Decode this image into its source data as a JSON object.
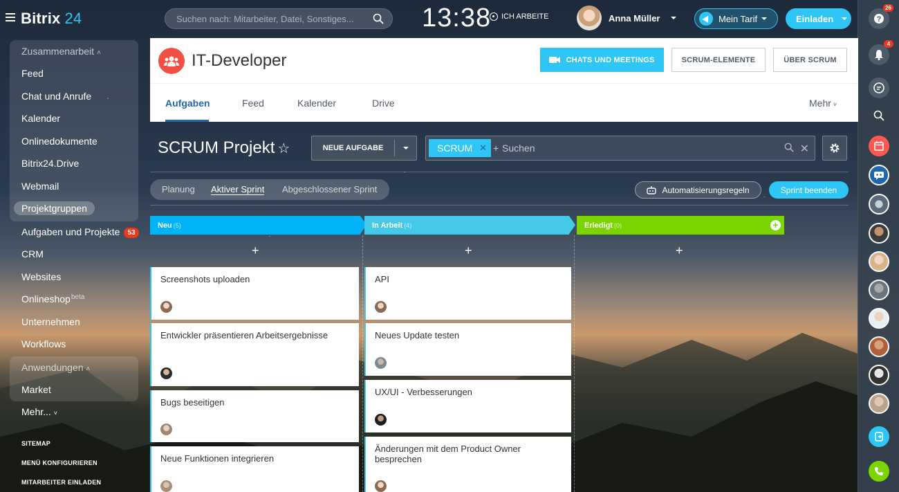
{
  "topbar": {
    "logo_text": "Bitrix",
    "logo_num": "24",
    "search_placeholder": "Suchen nach: Mitarbeiter, Datei, Sonstiges...",
    "clock": "13:38",
    "work_status": "ICH ARBEITE",
    "user_name": "Anna Müller",
    "tarif": "Mein Tarif",
    "invite": "Einladen"
  },
  "rail": {
    "help_badge": "26",
    "notifications_badge": "4"
  },
  "nav": {
    "group1_head": "Zusammenarbeit",
    "items1": [
      "Feed",
      "Chat und Anrufe",
      "Kalender",
      "Onlinedokumente",
      "Bitrix24.Drive",
      "Webmail",
      "Projektgruppen"
    ],
    "tasks": "Aufgaben und Projekte",
    "tasks_count": "53",
    "items2": [
      "CRM",
      "Websites"
    ],
    "shop": "Onlineshop",
    "shop_beta": "beta",
    "items3": [
      "Unternehmen",
      "Workflows"
    ],
    "group2_head": "Anwendungen",
    "market": "Market",
    "more": "Mehr...",
    "sitemap": "SITEMAP",
    "configure": "MENÜ KONFIGURIEREN",
    "invite_staff": "MITARBEITER EINLADEN"
  },
  "group": {
    "title": "IT-Developer",
    "btn_chats": "CHATS UND MEETINGS",
    "btn_elements": "SCRUM-ELEMENTE",
    "btn_about": "ÜBER SCRUM",
    "tabs": [
      "Aufgaben",
      "Feed",
      "Kalender",
      "Drive"
    ],
    "more": "Mehr"
  },
  "scrum": {
    "title": "SCRUM Projekt",
    "new_task": "NEUE AUFGABE",
    "filter_chip": "SCRUM",
    "filter_placeholder": "Suchen",
    "sprint_tabs": [
      "Planung",
      "Aktiver Sprint",
      "Abgeschlossener Sprint"
    ],
    "automation": "Automatisierungsregeln",
    "end_sprint": "Sprint beenden"
  },
  "kanban": {
    "columns": [
      {
        "title": "Neu",
        "count": "(5)"
      },
      {
        "title": "In Arbeit",
        "count": "(4)"
      },
      {
        "title": "Erledigt",
        "count": "(0)"
      }
    ],
    "col1_cards": [
      "Screenshots uploaden",
      "Entwickler präsentieren Arbeitsergebnisse",
      "Bugs beseitigen",
      "Neue Funktionen integrieren"
    ],
    "col2_cards": [
      "API",
      "Neues Update testen",
      "UX/UI - Verbesserungen",
      "Änderungen mit dem Product Owner besprechen"
    ]
  },
  "colors": {
    "accent": "#2fc6f6",
    "col_new": "#00b4f7",
    "col_progress": "#45c9e8",
    "col_done": "#7bd500",
    "counter": "#f1361b",
    "group_avatar": "#f34f43"
  }
}
